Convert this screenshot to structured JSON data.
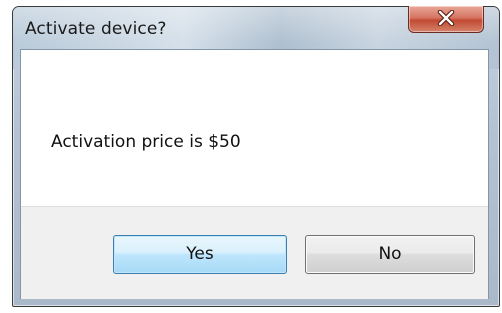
{
  "dialog": {
    "title": "Activate device?",
    "message": "Activation price is $50",
    "buttons": {
      "yes_label": "Yes",
      "no_label": "No"
    },
    "close_icon": "close-icon"
  }
}
